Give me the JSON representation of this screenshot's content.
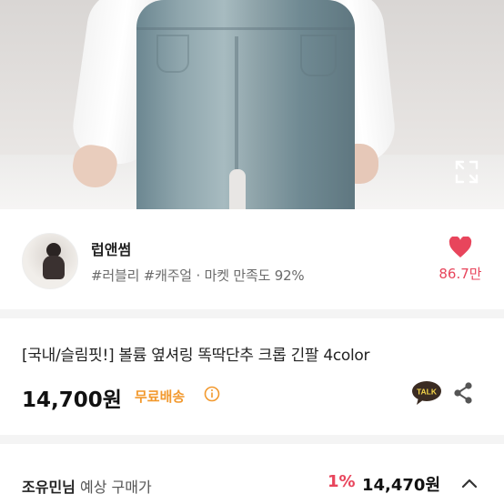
{
  "seller": {
    "name": "럽앤썸",
    "tags": "#러블리 #캐주얼 · 마켓 만족도 92%",
    "likes": "86.7만"
  },
  "product": {
    "title": "[국내/슬림핏!] 볼륨 옆셔링 똑딱단추 크롭 긴팔 4color",
    "price": "14,700원",
    "shipping": "무료배송"
  },
  "buyer": {
    "name": "조유민님",
    "label": " 예상 구매가",
    "discount": "1%",
    "price": "14,470원"
  },
  "icons": {
    "expand": "expand-icon",
    "heart": "heart-icon",
    "info": "info-icon",
    "talk": "kakao-talk-icon",
    "share": "share-icon",
    "chevron": "chevron-up-icon"
  },
  "colors": {
    "accent_pink": "#e8455c",
    "shipping_orange": "#f2992e"
  }
}
